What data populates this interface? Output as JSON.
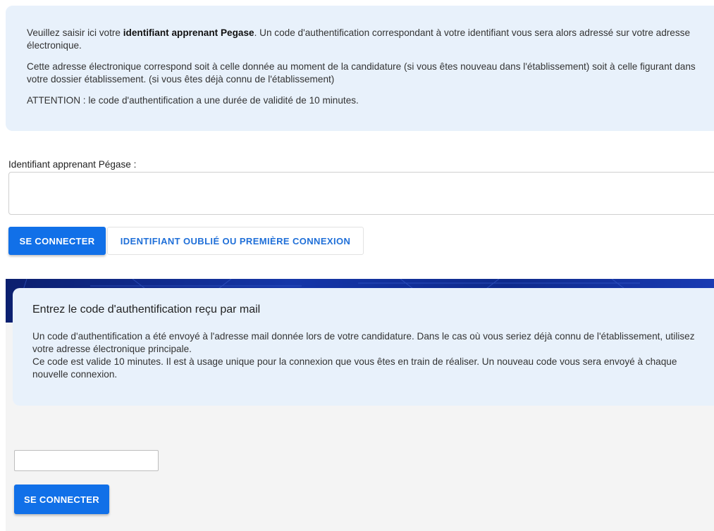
{
  "info": {
    "p1_before": "Veuillez saisir ici votre ",
    "p1_bold": "identifiant apprenant Pegase",
    "p1_after": ". Un code d'authentification correspondant à votre identifiant vous sera alors adressé sur votre adresse électronique.",
    "p2": "Cette adresse électronique correspond soit à celle donnée au moment de la candidature (si vous êtes nouveau dans l'établissement) soit à celle figurant dans votre dossier établissement. (si vous êtes déjà connu de l'établissement)",
    "p3": "ATTENTION : le code d'authentification a une durée de validité de 10 minutes."
  },
  "login_form": {
    "label": "Identifiant apprenant Pégase :",
    "input_value": "",
    "connect_label": "SE CONNECTER",
    "forgot_label": "IDENTIFIANT OUBLIÉ OU PREMIÈRE CONNEXION"
  },
  "code_section": {
    "title": "Entrez le code d'authentification reçu par mail",
    "line1": "Un code d'authentification a été envoyé à l'adresse mail donnée lors de votre candidature. Dans le cas où vous seriez déjà connu de l'établissement, utilisez votre adresse électronique principale.",
    "line2": "Ce code est valide 10 minutes. Il est à usage unique pour la connexion que vous êtes en train de réaliser. Un nouveau code vous sera envoyé à chaque nouvelle connexion.",
    "input_value": "",
    "connect_label": "SE CONNECTER"
  },
  "colors": {
    "primary": "#1170e8",
    "info_bg": "#e8f1fb",
    "banner": "#1536a8"
  }
}
